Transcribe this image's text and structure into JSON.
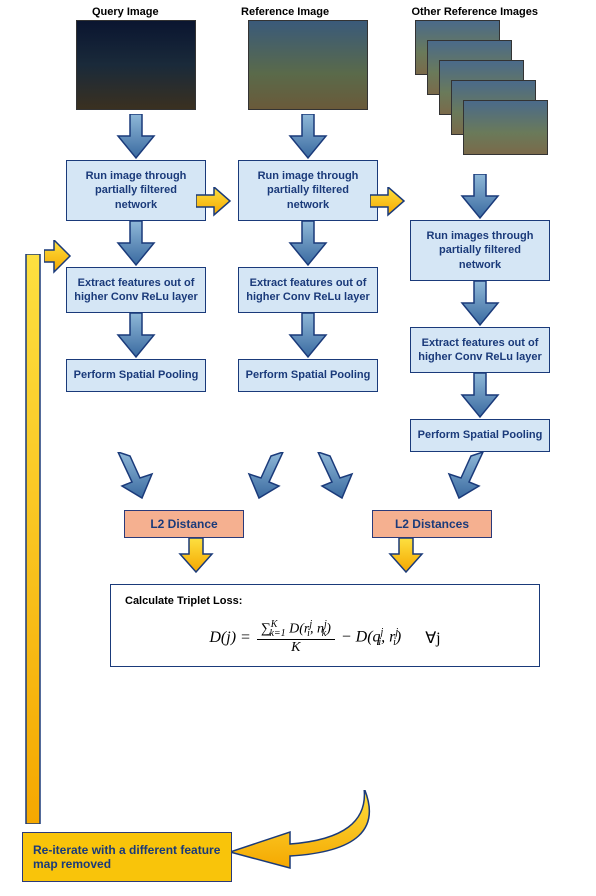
{
  "headers": {
    "query": "Query Image",
    "reference": "Reference Image",
    "other": "Other Reference Images"
  },
  "steps": {
    "run_network_single": "Run image through partially filtered network",
    "run_network_multi": "Run images through partially filtered network",
    "extract": "Extract features out of higher Conv ReLu layer",
    "pool": "Perform Spatial Pooling"
  },
  "l2": {
    "single": "L2 Distance",
    "multi": "L2 Distances"
  },
  "formula": {
    "title": "Calculate Triplet Loss:",
    "lhs": "D(j) = ",
    "num_prefix": "∑",
    "num_sup": "K",
    "num_sub": "k=1",
    "num_inner": " D(r",
    "r_sub": "i",
    "r_sup": "j",
    "num_mid": ", n",
    "n_sub": "k",
    "n_sup": "j",
    "num_close": ")",
    "den": "K",
    "minus": " − D(q",
    "q_sub": "i",
    "q_sup": "j",
    "mid2": ", r",
    "r2_sub": "i",
    "r2_sup": "j",
    "close2": ")",
    "forall": "∀j"
  },
  "reiterate": "Re-iterate with a different feature map removed"
}
